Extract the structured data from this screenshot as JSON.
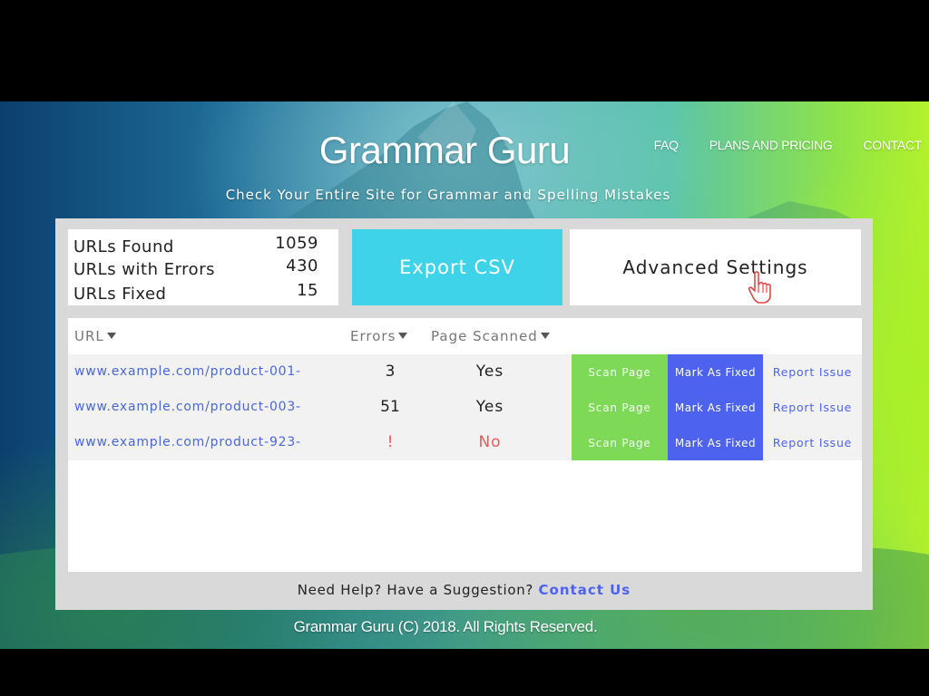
{
  "app": {
    "brand": "Grammar Guru",
    "tagline": "Check Your Entire Site for Grammar and Spelling Mistakes"
  },
  "nav": {
    "items": [
      {
        "label": "FAQ"
      },
      {
        "label": "PLANS AND PRICING"
      },
      {
        "label": "CONTACT"
      }
    ]
  },
  "stats": {
    "items": [
      {
        "label": "URLs Found",
        "value": "1059"
      },
      {
        "label": "URLs with Errors",
        "value": "430"
      },
      {
        "label": "URLs Fixed",
        "value": "15"
      }
    ]
  },
  "actions": {
    "export_label": "Export CSV",
    "settings_label": "Advanced Settings"
  },
  "table": {
    "headers": {
      "url": "URL",
      "errors": "Errors",
      "scanned": "Page Scanned"
    },
    "rows": [
      {
        "url": "www.example.com/product-001-",
        "errors": "3",
        "scanned": "Yes",
        "scan": "Scan Page",
        "fixed": "Mark As Fixed",
        "report": "Report Issue"
      },
      {
        "url": "www.example.com/product-003-",
        "errors": "51",
        "scanned": "Yes",
        "scan": "Scan Page",
        "fixed": "Mark As Fixed",
        "report": "Report Issue"
      },
      {
        "url": "www.example.com/product-923-",
        "errors": "!",
        "scanned": "No",
        "scan": "Scan Page",
        "fixed": "Mark As Fixed",
        "report": "Report Issue"
      }
    ]
  },
  "help": {
    "text": "Need Help? Have a Suggestion?",
    "link": "Contact Us"
  },
  "footer": {
    "text": "Grammar Guru (C) 2018. All Rights Reserved."
  },
  "colors": {
    "export": "#3ed3e8",
    "scan": "#7ed957",
    "fixed": "#4d63f0",
    "link": "#4a68d8",
    "error": "#e85a5a"
  },
  "icons": {
    "cursor": "hand-pointer-icon",
    "sort": "caret-down-icon"
  }
}
